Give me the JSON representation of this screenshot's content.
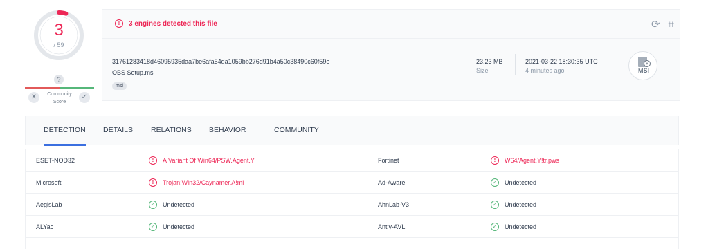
{
  "score": {
    "detections": "3",
    "total": "/ 59",
    "detection_ratio": 0.0508,
    "unknown_badge": "?",
    "community_label_line1": "Community",
    "community_label_line2": "Score",
    "vote_down_symbol": "✕",
    "vote_up_symbol": "✓",
    "accent_color": "#ed2756"
  },
  "summary": {
    "alert_text": "3 engines detected this file",
    "alert_icon": "!",
    "refresh_icon": "⟳",
    "graph_icon": "⌗",
    "hash": "31761283418d46095935daa7be6afa54da1059bb276d91b4a50c38490c60f59e",
    "filename": "OBS Setup.msi",
    "tag": "msi",
    "size_value": "23.23 MB",
    "size_label": "Size",
    "date_value": "2021-03-22 18:30:35 UTC",
    "date_ago": "4 minutes ago",
    "filetype_label": "MSI",
    "filetype_badge": "+"
  },
  "tabs": [
    {
      "label": "DETECTION",
      "active": true
    },
    {
      "label": "DETAILS",
      "active": false
    },
    {
      "label": "RELATIONS",
      "active": false
    },
    {
      "label": "BEHAVIOR",
      "active": false
    },
    {
      "label": "COMMUNITY",
      "active": false
    }
  ],
  "detections": [
    {
      "left_engine": "ESET-NOD32",
      "left_result": "A Variant Of Win64/PSW.Agent.Y",
      "left_icon": "!",
      "left_status": "detected",
      "right_engine": "Fortinet",
      "right_result": "W64/Agent.Y!tr.pws",
      "right_icon": "!",
      "right_status": "detected"
    },
    {
      "left_engine": "Microsoft",
      "left_result": "Trojan:Win32/Caynamer.A!ml",
      "left_icon": "!",
      "left_status": "detected",
      "right_engine": "Ad-Aware",
      "right_result": "Undetected",
      "right_icon": "✓",
      "right_status": "undetected"
    },
    {
      "left_engine": "AegisLab",
      "left_result": "Undetected",
      "left_icon": "✓",
      "left_status": "undetected",
      "right_engine": "AhnLab-V3",
      "right_result": "Undetected",
      "right_icon": "✓",
      "right_status": "undetected"
    },
    {
      "left_engine": "ALYac",
      "left_result": "Undetected",
      "left_icon": "✓",
      "left_status": "undetected",
      "right_engine": "Antiy-AVL",
      "right_result": "Undetected",
      "right_icon": "✓",
      "right_status": "undetected"
    }
  ]
}
